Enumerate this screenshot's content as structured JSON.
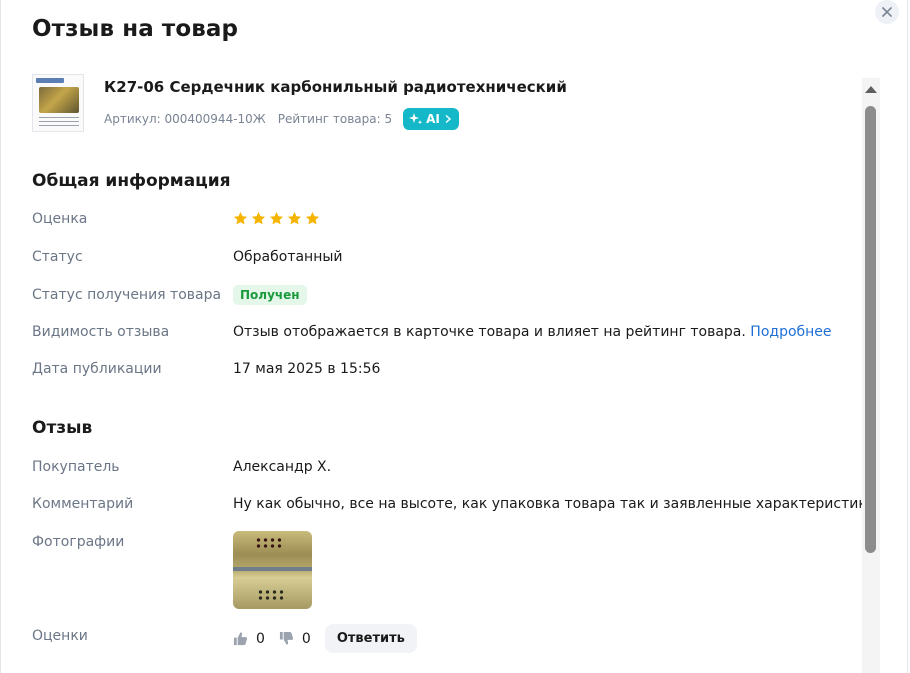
{
  "title": "Отзыв на товар",
  "product": {
    "name": "К27-06 Сердечник карбонильный радиотехнический",
    "article": "Артикул: 000400944-10Ж",
    "rating": "Рейтинг товара: 5",
    "ai_label": "AI"
  },
  "general": {
    "title": "Общая информация",
    "rating_label": "Оценка",
    "stars": 5,
    "star_color": "#f5b400",
    "status_label": "Статус",
    "status_value": "Обработанный",
    "receipt_label": "Статус получения товара",
    "receipt_value": "Получен",
    "visibility_label": "Видимость отзыва",
    "visibility_value": "Отзыв отображается в карточке товара и влияет на рейтинг товара.",
    "visibility_link": "Подробнее",
    "date_label": "Дата публикации",
    "date_value": "17 мая 2025 в 15:56"
  },
  "review": {
    "title": "Отзыв",
    "buyer_label": "Покупатель",
    "buyer_value": "Александр Х.",
    "comment_label": "Комментарий",
    "comment_value": "Ну как обычно, все на высоте, как упаковка товара так и заявленные характеристики.",
    "photos_label": "Фотографии",
    "votes_label": "Оценки",
    "likes": "0",
    "dislikes": "0",
    "reply_label": "Ответить"
  },
  "colors": {
    "accent_ai": "#14b8c8",
    "link": "#1f6fd6",
    "status_green": "#1a9a3d"
  }
}
